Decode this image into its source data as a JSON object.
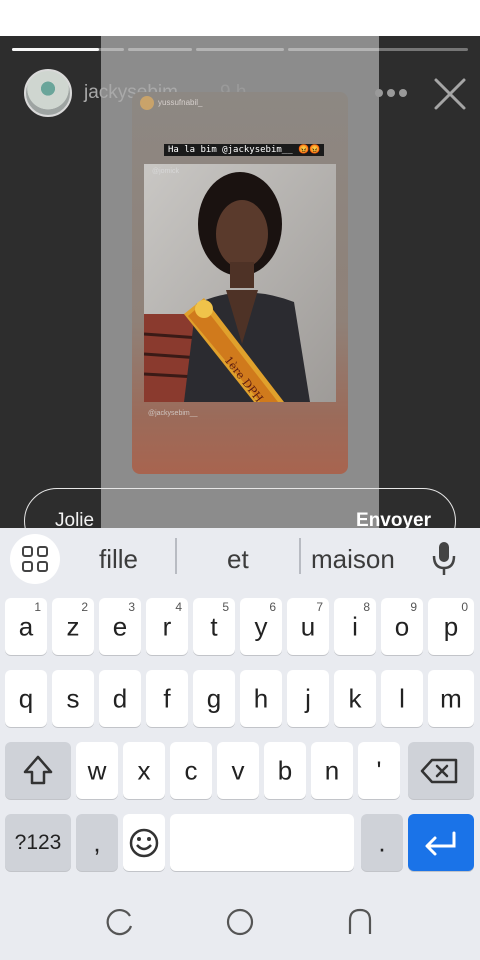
{
  "story": {
    "username": "jackysebim__",
    "time": "9 h",
    "card": {
      "shared_user": "yussufnabil_",
      "caption": "Ha la bim @jackysebim__ 😡😡",
      "photo_handle_top": "@jomick",
      "photo_handle_bottom": "@jackysebim__"
    }
  },
  "reply": {
    "value": "Jolie",
    "send_label": "Envoyer"
  },
  "keyboard": {
    "suggestions": [
      "fille",
      "et",
      "maison"
    ],
    "row1": [
      {
        "ch": "a",
        "num": "1"
      },
      {
        "ch": "z",
        "num": "2"
      },
      {
        "ch": "e",
        "num": "3"
      },
      {
        "ch": "r",
        "num": "4"
      },
      {
        "ch": "t",
        "num": "5"
      },
      {
        "ch": "y",
        "num": "6"
      },
      {
        "ch": "u",
        "num": "7"
      },
      {
        "ch": "i",
        "num": "8"
      },
      {
        "ch": "o",
        "num": "9"
      },
      {
        "ch": "p",
        "num": "0"
      }
    ],
    "row2": [
      "q",
      "s",
      "d",
      "f",
      "g",
      "h",
      "j",
      "k",
      "l",
      "m"
    ],
    "row3": [
      "w",
      "x",
      "c",
      "v",
      "b",
      "n",
      "'"
    ],
    "row4": {
      "symbols": "?123",
      "comma": ",",
      "period": "."
    }
  },
  "colors": {
    "accent_blue": "#1a73e8",
    "story_bg": "#2d2d2d",
    "keyboard_bg": "#e9ebf0"
  },
  "icons": [
    "more-icon",
    "close-icon",
    "grid-icon",
    "mic-icon",
    "shift-icon",
    "backspace-icon",
    "emoji-icon",
    "enter-icon",
    "recents-icon",
    "home-icon",
    "back-icon"
  ]
}
